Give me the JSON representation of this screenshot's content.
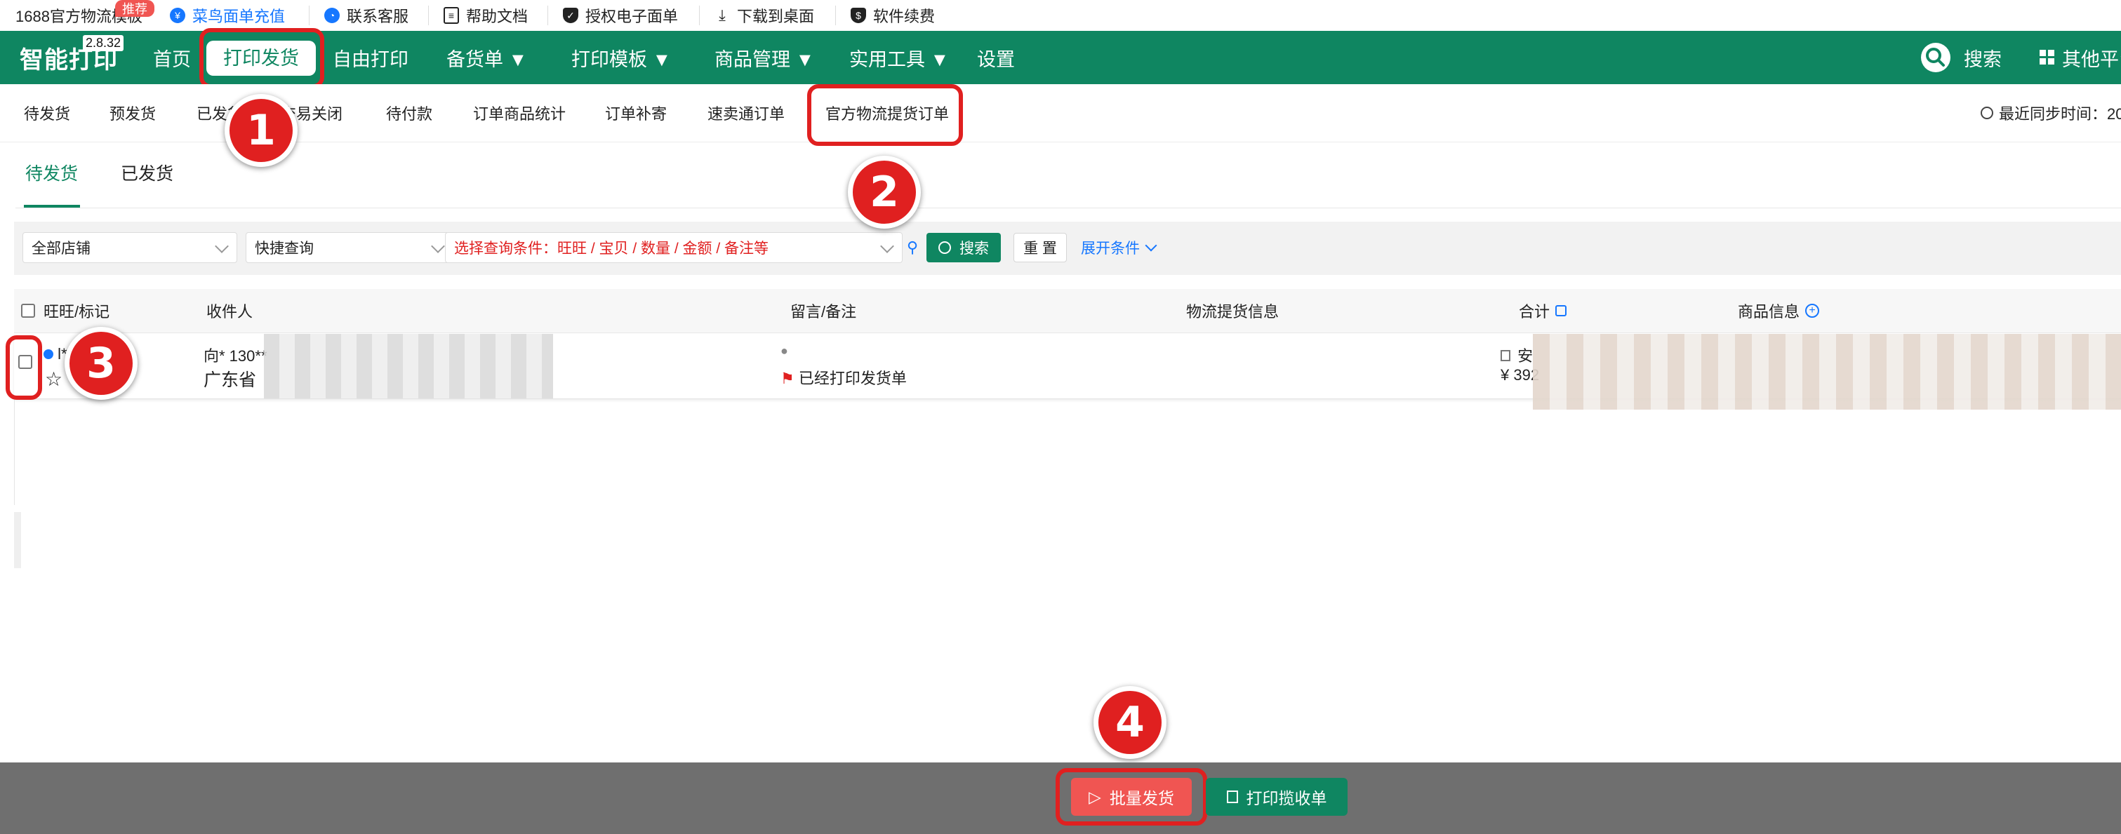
{
  "topbar": {
    "items": [
      {
        "label": "1688官方物流模板"
      },
      {
        "label": "菜鸟面单充值",
        "icon": "yen-icon"
      },
      {
        "label": "联系客服",
        "icon": "chat-icon"
      },
      {
        "label": "帮助文档",
        "icon": "document-icon"
      },
      {
        "label": "授权电子面单",
        "icon": "shield-icon"
      },
      {
        "label": "下载到桌面",
        "icon": "download-icon"
      },
      {
        "label": "软件续费",
        "icon": "shield-icon"
      }
    ],
    "badge": "推荐"
  },
  "nav": {
    "logo": "智能打印",
    "version": "2.8.32",
    "items": [
      {
        "label": "首页"
      },
      {
        "label": "打印发货"
      },
      {
        "label": "自由打印"
      },
      {
        "label": "备货单 ▼"
      },
      {
        "label": "打印模板 ▼"
      },
      {
        "label": "商品管理 ▼"
      },
      {
        "label": "实用工具 ▼"
      },
      {
        "label": "设置"
      }
    ],
    "search_label": "搜索",
    "other_label": "其他平台"
  },
  "subnav": {
    "items": [
      {
        "label": "待发货"
      },
      {
        "label": "预发货"
      },
      {
        "label": "已发货"
      },
      {
        "label": "交易关闭"
      },
      {
        "label": "待付款"
      },
      {
        "label": "订单商品统计"
      },
      {
        "label": "订单补寄"
      },
      {
        "label": "速卖通订单"
      },
      {
        "label": "官方物流提货订单"
      }
    ],
    "sync_label": "最近同步时间：20"
  },
  "tabs": [
    {
      "label": "待发货",
      "active": true
    },
    {
      "label": "已发货",
      "active": false
    }
  ],
  "filters": {
    "store": "全部店铺",
    "quick": "快捷查询",
    "condition": "选择查询条件：旺旺 / 宝贝 / 数量 / 金额 / 备注等",
    "search_button": "搜索",
    "reset_button": "重 置",
    "expand_label": "展开条件"
  },
  "table": {
    "headers": {
      "wangwang": "旺旺/标记",
      "receiver": "收件人",
      "message": "留言/备注",
      "logistics": "物流提货信息",
      "total": "合计",
      "goods": "商品信息"
    },
    "row": {
      "wangwang": "l*",
      "receiver_line1": "向* 130**",
      "receiver_line2": "广东省",
      "remark": "已经打印发货单",
      "total_line1": "安",
      "total_line2": "¥ 392"
    }
  },
  "annotations": [
    "1",
    "2",
    "3",
    "4"
  ],
  "bottom": {
    "batch_label": "批量发货",
    "print_label": "打印揽收单"
  },
  "colors": {
    "primary": "#0f8661",
    "accent_red": "#e02020",
    "button_red": "#f05552",
    "link_blue": "#1677ff"
  }
}
